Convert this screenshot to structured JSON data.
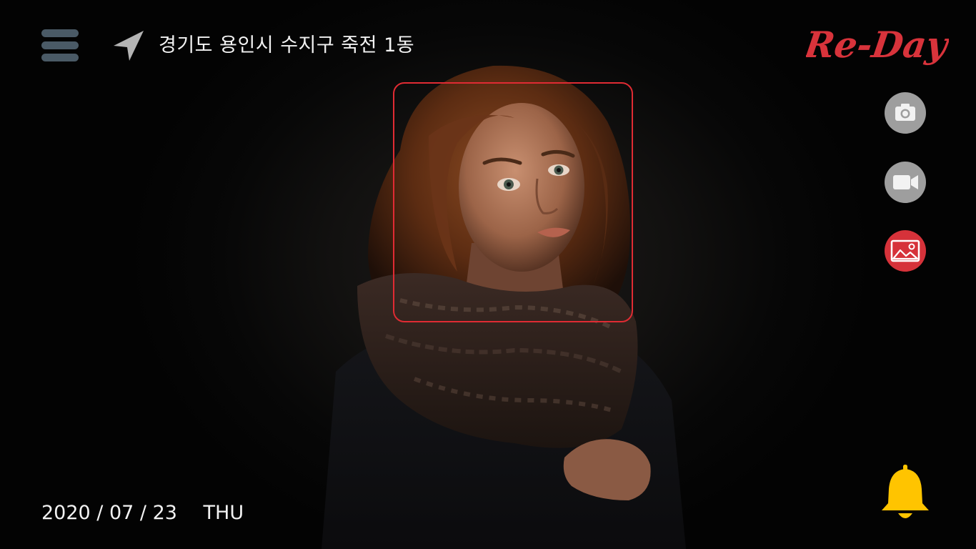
{
  "header": {
    "menu_icon": "hamburger-menu-icon",
    "location_icon": "navigation-arrow-icon",
    "location_text": "경기도 용인시 수지구 죽전 1동",
    "logo_text": "Re-Day",
    "logo_color": "#d8333b"
  },
  "side_buttons": [
    {
      "name": "camera",
      "icon": "camera-icon",
      "color": "#9e9e9e"
    },
    {
      "name": "video",
      "icon": "video-camera-icon",
      "color": "#9e9e9e"
    },
    {
      "name": "gallery",
      "icon": "image-gallery-icon",
      "color": "#d6323a",
      "active": true
    }
  ],
  "face_detection": {
    "frame_color": "#e02b33"
  },
  "footer": {
    "date": "2020 / 07 / 23",
    "weekday": "THU",
    "bell_icon": "notification-bell-icon",
    "bell_color": "#ffc400"
  }
}
